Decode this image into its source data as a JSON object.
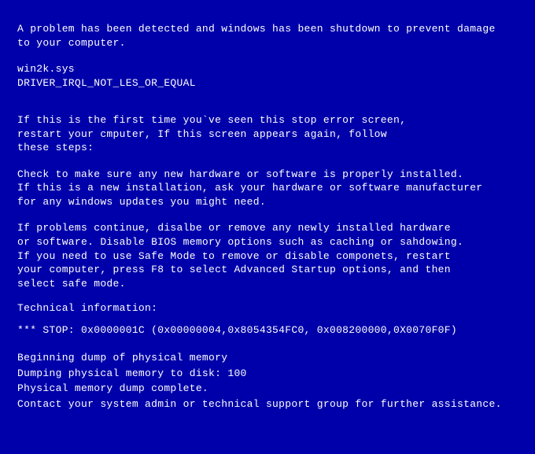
{
  "header": {
    "line1": "A problem has been detected and windows has been shutdown to prevent damage",
    "line2": "to your computer."
  },
  "module": {
    "filename": "win2k.sys",
    "errorName": "DRIVER_IRQL_NOT_LES_OR_EQUAL"
  },
  "instructions": {
    "firstTime1": "If this is the first time you`ve seen this stop error screen,",
    "firstTime2": "restart your cmputer, If this screen appears again, follow",
    "firstTime3": "these steps:",
    "check1": "Check to make sure any new hardware or software is properly installed.",
    "check2": "If this is a new installation, ask your hardware or software manufacturer",
    "check3": "for any windows updates you might need.",
    "problems1": "If problems continue, disalbe or remove any newly installed hardware",
    "problems2": "or software. Disable BIOS memory options such as caching or sahdowing.",
    "problems3": "If you need to use Safe Mode to remove or disable componets, restart",
    "problems4": "your computer, press F8 to select Advanced Startup options, and then",
    "problems5": "select safe mode."
  },
  "technical": {
    "header": "Technical  information:",
    "stopLine": "*** STOP: 0x0000001C (0x00000004,0x8054354FC0, 0x008200000,0X0070F0F)"
  },
  "dump": {
    "begin": "Beginning dump of physical memory",
    "progress": "Dumping physical memory to disk:  100",
    "complete": "Physical memory dump complete.",
    "contact": "Contact your system admin or technical support group for further assistance."
  }
}
